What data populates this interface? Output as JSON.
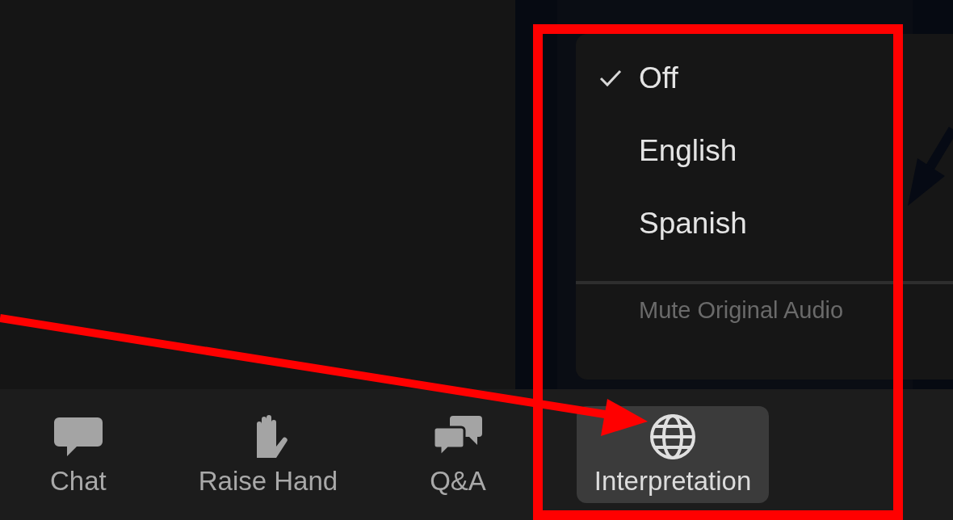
{
  "menu": {
    "items": [
      {
        "label": "Off",
        "checked": true
      },
      {
        "label": "English",
        "checked": false
      },
      {
        "label": "Spanish",
        "checked": false
      }
    ],
    "footer": {
      "label": "Mute Original Audio",
      "disabled": true
    }
  },
  "toolbar": {
    "buttons": [
      {
        "kind": "chat",
        "label": "Chat",
        "selected": false
      },
      {
        "kind": "hand",
        "label": "Raise Hand",
        "selected": false
      },
      {
        "kind": "qa",
        "label": "Q&A",
        "selected": false
      },
      {
        "kind": "globe",
        "label": "Interpretation",
        "selected": true
      }
    ]
  },
  "annotations": [
    {
      "kind": "frame"
    },
    {
      "kind": "arrow"
    },
    {
      "kind": "dark-arrow"
    }
  ]
}
